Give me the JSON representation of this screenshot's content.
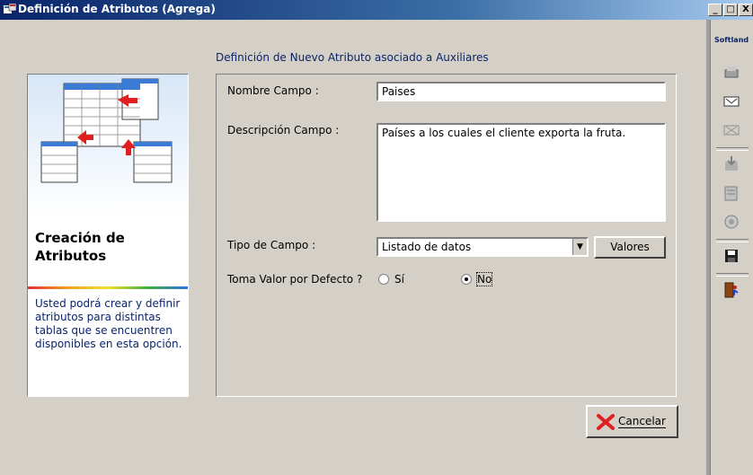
{
  "window": {
    "title": "Definición de Atributos (Agrega)",
    "minimize": "_",
    "maximize": "□",
    "close": "X"
  },
  "caption": "Definición de Nuevo Atributo asociado a Auxiliares",
  "sidebar": {
    "heading": "Creación de Atributos",
    "description": "Usted podrá crear y definir atributos para distintas tablas que se encuentren disponibles en esta opción."
  },
  "form": {
    "nombre_label": "Nombre Campo :",
    "nombre_value": "Paises",
    "descripcion_label": "Descripción Campo :",
    "descripcion_value": "Países a los cuales el cliente exporta la fruta.",
    "tipo_label": "Tipo de Campo :",
    "tipo_value": "Listado de datos",
    "valores_button": "Valores",
    "defecto_label": "Toma Valor por Defecto ?",
    "si_label": "Sí",
    "no_label": "No",
    "defecto_selected": "No"
  },
  "cancel_button": "Cancelar",
  "toolbar": {
    "brand": "Softland",
    "tools": [
      "print-icon",
      "approve-icon",
      "delete-icon",
      "import-icon",
      "edit-icon",
      "copy-icon",
      "save-icon",
      "exit-icon"
    ]
  }
}
